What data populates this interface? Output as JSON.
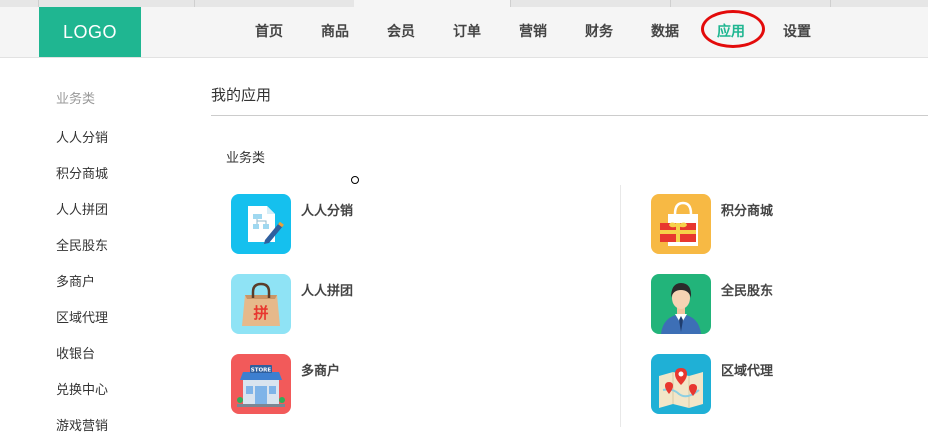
{
  "header": {
    "logo": "LOGO",
    "nav": [
      "首页",
      "商品",
      "会员",
      "订单",
      "营销",
      "财务",
      "数据",
      "应用",
      "设置"
    ],
    "active_nav": "应用"
  },
  "sidebar": {
    "title": "业务类",
    "items": [
      "人人分销",
      "积分商城",
      "人人拼团",
      "全民股东",
      "多商户",
      "区域代理",
      "收银台",
      "兑换中心",
      "游戏营销"
    ]
  },
  "main": {
    "title": "我的应用",
    "section": "业务类",
    "apps": [
      {
        "name": "人人分销",
        "icon": "distribution-icon",
        "color": "#15c0ee"
      },
      {
        "name": "积分商城",
        "icon": "gift-bag-icon",
        "color": "#f7b944"
      },
      {
        "name": "人人拼团",
        "icon": "shopping-bag-icon",
        "color": "#8fe3f5"
      },
      {
        "name": "全民股东",
        "icon": "shareholder-icon",
        "color": "#22b47a"
      },
      {
        "name": "多商户",
        "icon": "store-icon",
        "color": "#f25a5a"
      },
      {
        "name": "区域代理",
        "icon": "map-pin-icon",
        "color": "#1fb0d6"
      }
    ]
  },
  "colors": {
    "accent": "#1fb691",
    "annotation": "#e30b0b"
  }
}
